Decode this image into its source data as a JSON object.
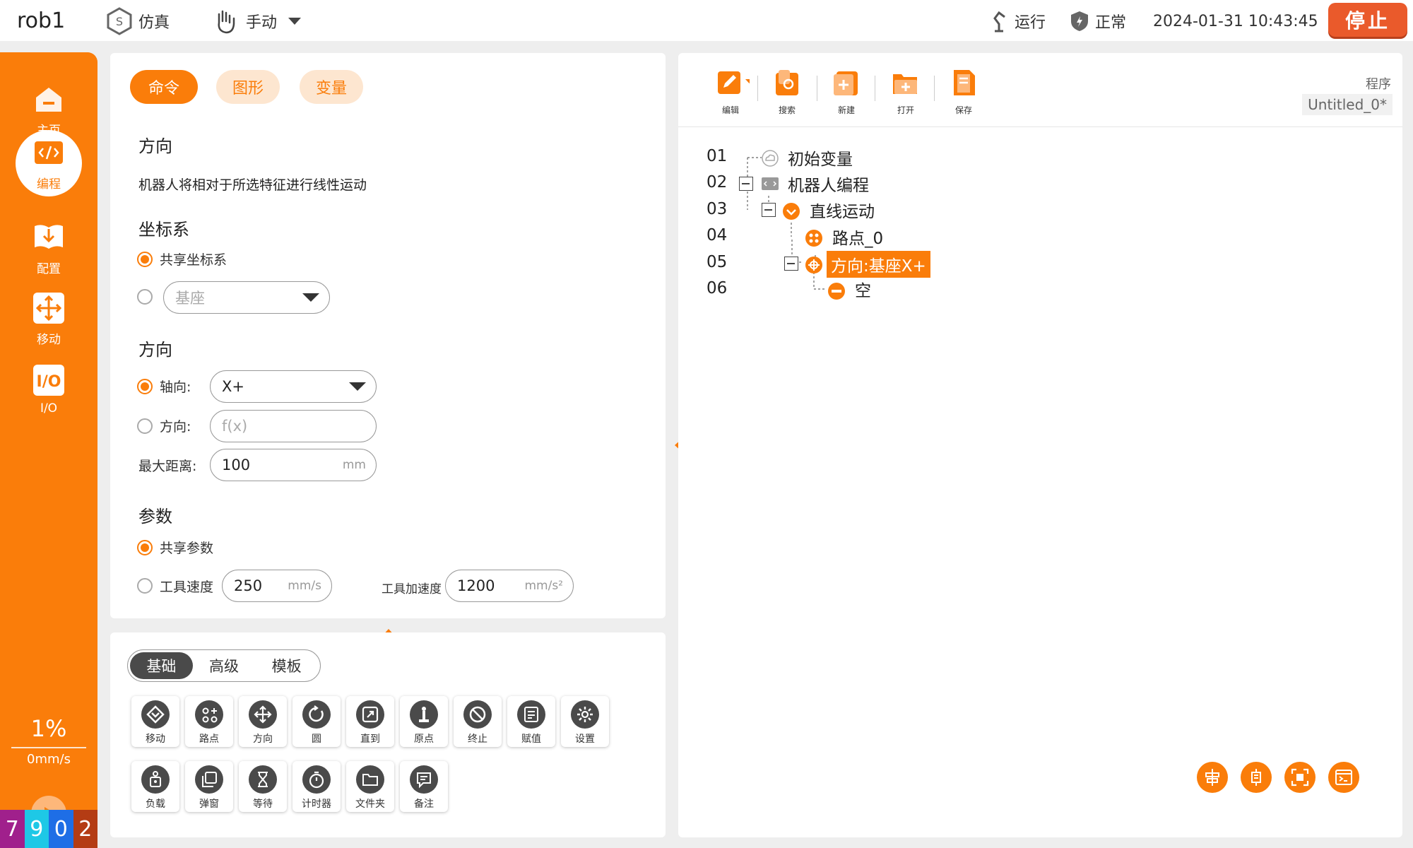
{
  "topbar": {
    "robot_name": "rob1",
    "sim_label": "仿真",
    "mode_label": "手动",
    "run_label": "运行",
    "status_label": "正常",
    "datetime": "2024-01-31 10:43:45",
    "stop_label": "停止"
  },
  "sidebar": {
    "items": [
      {
        "label": "主页",
        "icon": "home-icon"
      },
      {
        "label": "编程",
        "icon": "code-icon"
      },
      {
        "label": "配置",
        "icon": "config-icon"
      },
      {
        "label": "移动",
        "icon": "move-icon"
      },
      {
        "label": "I/O",
        "icon": "io-icon"
      }
    ],
    "active_index": 1,
    "speed_percent": "1%",
    "speed_value": "0mm/s",
    "counter": [
      "7",
      "9",
      "0",
      "2"
    ],
    "counter_colors": [
      "#a0208c",
      "#1ec8e6",
      "#1e6ee6",
      "#b43c14"
    ]
  },
  "command_panel": {
    "tabs": [
      "命令",
      "图形",
      "变量"
    ],
    "active_tab": 0,
    "title": "方向",
    "description": "机器人将相对于所选特征进行线性运动",
    "frame_section": "坐标系",
    "shared_frame_label": "共享坐标系",
    "frame_select_value": "基座",
    "direction_section": "方向",
    "axis_label": "轴向:",
    "axis_value": "X+",
    "direction_label": "方向:",
    "direction_placeholder": "f(x)",
    "max_distance_label": "最大距离:",
    "max_distance_value": "100",
    "max_distance_unit": "mm",
    "params_section": "参数",
    "shared_params_label": "共享参数",
    "tool_speed_label": "工具速度",
    "tool_speed_value": "250",
    "tool_speed_unit": "mm/s",
    "tool_accel_label": "工具加速度",
    "tool_accel_value": "1200",
    "tool_accel_unit": "mm/s²"
  },
  "palette": {
    "segments": [
      "基础",
      "高级",
      "模板"
    ],
    "active_segment": 0,
    "row1": [
      "移动",
      "路点",
      "方向",
      "圆",
      "直到",
      "原点",
      "终止",
      "赋值",
      "设置"
    ],
    "row2": [
      "负载",
      "弹窗",
      "等待",
      "计时器",
      "文件夹",
      "备注"
    ]
  },
  "program": {
    "toolbar": [
      "编辑",
      "搜索",
      "新建",
      "打开",
      "保存"
    ],
    "program_label": "程序",
    "program_name": "Untitled_0*",
    "lines": [
      {
        "no": "01",
        "text": "初始变量"
      },
      {
        "no": "02",
        "text": "机器人编程"
      },
      {
        "no": "03",
        "text": "直线运动"
      },
      {
        "no": "04",
        "text": "路点_0"
      },
      {
        "no": "05",
        "text": "方向:基座X+"
      },
      {
        "no": "06",
        "text": "空"
      }
    ]
  },
  "colors": {
    "accent": "#fa7d0a",
    "stop": "#ea5a2b"
  }
}
